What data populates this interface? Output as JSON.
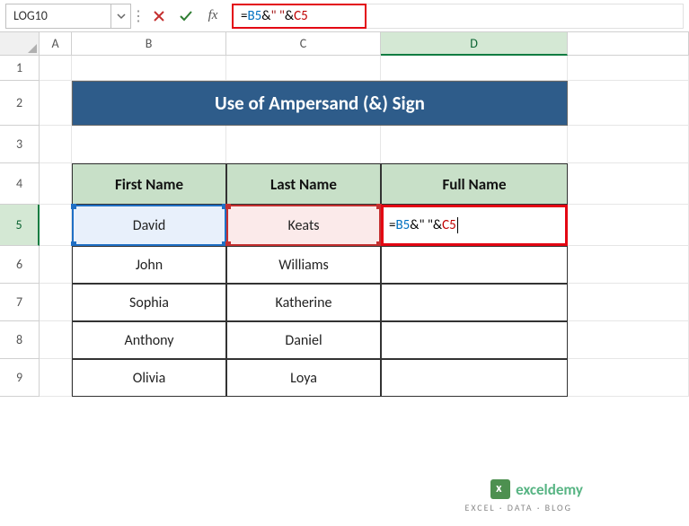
{
  "nameBox": "LOG10",
  "formulaBar": {
    "eq": "=",
    "refB": "B5",
    "amp1": "&",
    "str": "\" \"",
    "amp2": "&",
    "refC": "C5"
  },
  "columns": [
    "A",
    "B",
    "C",
    "D"
  ],
  "rowNums": [
    "1",
    "2",
    "3",
    "4",
    "5",
    "6",
    "7",
    "8",
    "9"
  ],
  "title": "Use of Ampersand (&) Sign",
  "headers": {
    "first": "First Name",
    "last": "Last Name",
    "full": "Full Name"
  },
  "table": [
    {
      "first": "David",
      "last": "Keats",
      "full_formula": true
    },
    {
      "first": "John",
      "last": "Williams",
      "full": ""
    },
    {
      "first": "Sophia",
      "last": "Katherine",
      "full": ""
    },
    {
      "first": "Anthony",
      "last": "Daniel",
      "full": ""
    },
    {
      "first": "Olivia",
      "last": "Loya",
      "full": ""
    }
  ],
  "activeCellFormula": {
    "eq": "=",
    "refB": "B5",
    "amp1": "&",
    "str": "\" \"",
    "amp2": "&",
    "refC": "C5"
  },
  "watermark": {
    "name": "exceldemy",
    "tagline": "EXCEL · DATA · BLOG"
  }
}
